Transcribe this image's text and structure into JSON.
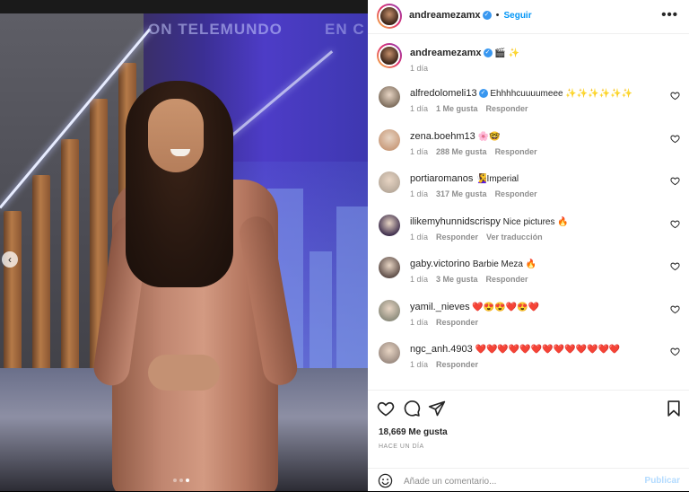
{
  "post": {
    "author": "andreamezamx",
    "follow_label": "Seguir",
    "more_label": "•••",
    "caption_emojis": "🎬 ✨",
    "caption_time": "1 día",
    "slide_count": 3,
    "active_slide": 3,
    "photo_sign_left": "ON TELEMUNDO",
    "photo_sign_right": "EN C"
  },
  "comments": [
    {
      "user": "alfredolomeli13",
      "verified": true,
      "text": "Ehhhhcuuuumeee ✨✨✨✨✨✨",
      "time": "1 día",
      "likes": "1 Me gusta",
      "reply": "Responder",
      "avatar_color": "#7a6a5a"
    },
    {
      "user": "zena.boehm13",
      "verified": false,
      "text": "🌸🤓",
      "time": "1 día",
      "likes": "288 Me gusta",
      "reply": "Responder",
      "avatar_color": "#c89a7a"
    },
    {
      "user": "portiaromanos",
      "verified": false,
      "text": "🧏‍♀️Imperial",
      "time": "1 día",
      "likes": "317 Me gusta",
      "reply": "Responder",
      "avatar_color": "#b7a99a"
    },
    {
      "user": "ilikemyhunnidscrispy",
      "verified": false,
      "text": "Nice pictures 🔥",
      "time": "1 día",
      "likes": "",
      "reply": "Responder",
      "translate": "Ver traducción",
      "avatar_color": "#3a2a4a"
    },
    {
      "user": "gaby.victorino",
      "verified": false,
      "text": "Barbie Meza 🔥",
      "time": "1 día",
      "likes": "3 Me gusta",
      "reply": "Responder",
      "avatar_color": "#5a4a45"
    },
    {
      "user": "yamil._nieves",
      "verified": false,
      "text": "❤️😍😍❤️😍❤️",
      "time": "1 día",
      "likes": "",
      "reply": "Responder",
      "avatar_color": "#8a8a7a"
    },
    {
      "user": "ngc_anh.4903",
      "verified": false,
      "text": "❤️❤️❤️❤️❤️❤️❤️❤️❤️❤️❤️❤️❤️",
      "time": "1 día",
      "likes": "",
      "reply": "Responder",
      "avatar_color": "#9a8a80"
    }
  ],
  "footer": {
    "likes": "18,669 Me gusta",
    "ago": "HACE UN DÍA",
    "comment_placeholder": "Añade un comentario...",
    "publish_label": "Publicar"
  },
  "colors": {
    "accent": "#0095f6",
    "verified": "#3897f0",
    "muted": "#8e8e8e",
    "text": "#262626",
    "publish_disabled": "#b3dbff"
  }
}
